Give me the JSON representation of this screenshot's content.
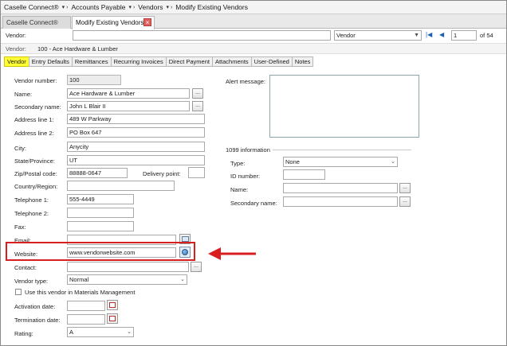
{
  "breadcrumb": [
    "Caselle Connect®",
    "Accounts Payable",
    "Vendors",
    "Modify Existing Vendors"
  ],
  "doc_tabs": [
    {
      "label": "Caselle Connect®",
      "active": false
    },
    {
      "label": "Modify Existing Vendors",
      "active": true
    }
  ],
  "search": {
    "label": "Vendor:",
    "value": "",
    "mode": "Vendor",
    "page_value": "1",
    "page_total": "of 54"
  },
  "vendor_info": {
    "label": "Vendor:",
    "value": "100 - Ace Hardware & Lumber"
  },
  "tabs": [
    "Vendor",
    "Entry Defaults",
    "Remittances",
    "Recurring Invoices",
    "Direct Payment",
    "Attachments",
    "User-Defined",
    "Notes"
  ],
  "active_tab": "Vendor",
  "form": {
    "vendor_number": {
      "label": "Vendor number:",
      "value": "100"
    },
    "name": {
      "label": "Name:",
      "value": "Ace Hardware & Lumber"
    },
    "secondary_name": {
      "label": "Secondary name:",
      "value": "John L Blair II"
    },
    "address1": {
      "label": "Address line 1:",
      "value": "489 W Parkway"
    },
    "address2": {
      "label": "Address line 2:",
      "value": "PO Box 647"
    },
    "city": {
      "label": "City:",
      "value": "Anycity"
    },
    "state": {
      "label": "State/Province:",
      "value": "UT"
    },
    "zip": {
      "label": "Zip/Postal code:",
      "value": "88888-0647"
    },
    "delivery_point": {
      "label": "Delivery point:",
      "value": ""
    },
    "country": {
      "label": "Country/Region:",
      "value": ""
    },
    "telephone1": {
      "label": "Telephone 1:",
      "value": "555-4449"
    },
    "telephone2": {
      "label": "Telephone 2:",
      "value": ""
    },
    "fax": {
      "label": "Fax:",
      "value": ""
    },
    "email": {
      "label": "Email:",
      "value": ""
    },
    "website": {
      "label": "Website:",
      "value": "www.vendorwebsite.com"
    },
    "contact": {
      "label": "Contact:",
      "value": ""
    },
    "vendor_type": {
      "label": "Vendor type:",
      "value": "Normal"
    },
    "materials_mgmt": {
      "label": "Use this vendor in Materials Management",
      "checked": false
    },
    "activation_date": {
      "label": "Activation date:",
      "value": ""
    },
    "termination_date": {
      "label": "Termination date:",
      "value": ""
    },
    "rating": {
      "label": "Rating:",
      "value": "A"
    }
  },
  "alert": {
    "label": "Alert message:",
    "value": ""
  },
  "info1099": {
    "title": "1099 information",
    "type": {
      "label": "Type:",
      "value": "None"
    },
    "id_number": {
      "label": "ID number:",
      "value": ""
    },
    "name": {
      "label": "Name:",
      "value": ""
    },
    "secondary_name": {
      "label": "Secondary name:",
      "value": ""
    }
  },
  "ellipsis": "...",
  "highlight_color": "#d81e1e",
  "active_tab_color": "#ffff33"
}
